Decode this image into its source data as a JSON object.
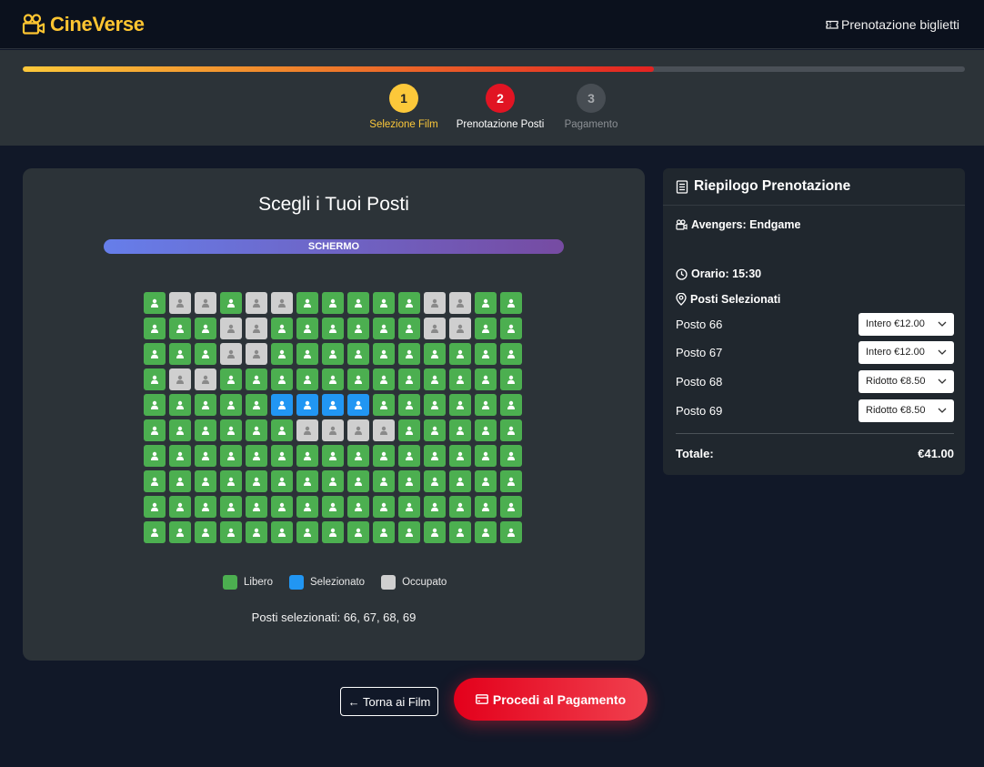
{
  "app": {
    "brand": "CineVerse",
    "nav_link": "Prenotazione biglietti",
    "brand_color": "#ffc531",
    "brand_icon": "film-camera-icon"
  },
  "progress": {
    "fraction": 0.67,
    "steps": [
      {
        "number": "1",
        "label": "Selezione Film",
        "state": "completed"
      },
      {
        "number": "2",
        "label": "Prenotazione Posti",
        "state": "active"
      },
      {
        "number": "3",
        "label": "Pagamento",
        "state": "pending"
      }
    ]
  },
  "seat_map": {
    "title": "Scegli i Tuoi Posti",
    "screen_label": "SCHERMO",
    "columns": 15,
    "rows": [
      "FOOFOOFFFFFOOFF",
      "FFFOOFFFFFFOOFF",
      "FFFOOFFFFFFFFFF",
      "FOOFFFFFFFFFFFF",
      "FFFFFSSSSFFFFFF",
      "FFFFFFOOOOFFFFF",
      "FFFFFFFFFFFFFFF",
      "FFFFFFFFFFFFFFF",
      "FFFFFFFFFFFFFFF",
      "FFFFFFFFFFFFFFF"
    ],
    "row_legend_codes": {
      "F": "free",
      "S": "selected",
      "O": "occupied"
    },
    "legend": {
      "free": "Libero",
      "selected": "Selezionato",
      "occupied": "Occupato"
    },
    "selected_text": "Posti selezionati: 66, 67, 68, 69",
    "colors": {
      "free": "#4caf50",
      "selected": "#2196f3",
      "occupied": "#cfcfcf"
    }
  },
  "actions": {
    "back_label": "← Torna ai Film",
    "pay_label": "Procedi al Pagamento"
  },
  "summary": {
    "title": "Riepilogo Prenotazione",
    "movie": "Avengers: Endgame",
    "time": "Orario: 15:30",
    "seats_heading": "Posti Selezionati",
    "seats": [
      {
        "label": "Posto 66",
        "ticket": "Intero €12.00"
      },
      {
        "label": "Posto 67",
        "ticket": "Intero €12.00"
      },
      {
        "label": "Posto 68",
        "ticket": "Ridotto €8.50"
      },
      {
        "label": "Posto 69",
        "ticket": "Ridotto €8.50"
      }
    ],
    "total_label": "Totale:",
    "total_value": "€41.00"
  }
}
